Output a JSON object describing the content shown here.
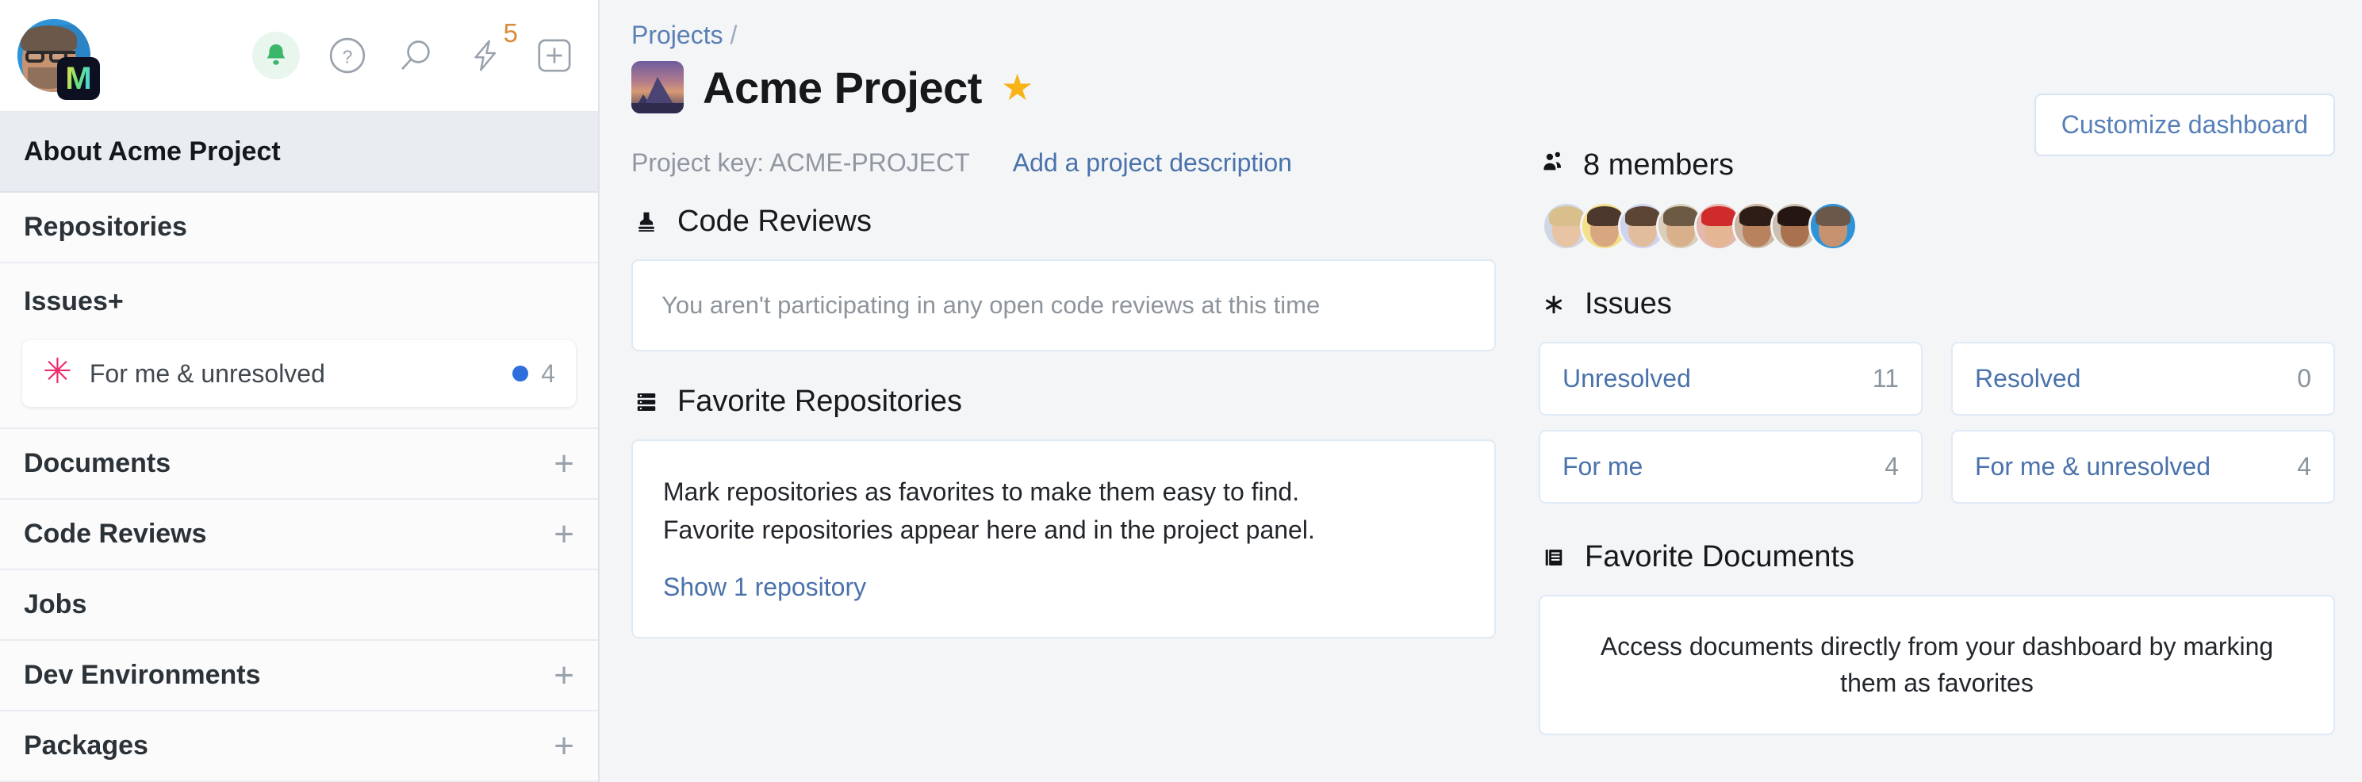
{
  "sidebar": {
    "user": {
      "avatar_name": "user-avatar",
      "badge_letter": "M"
    },
    "toolbar": [
      {
        "name": "notifications-bell-icon",
        "label": ""
      },
      {
        "name": "help-icon",
        "label": "?"
      },
      {
        "name": "search-icon",
        "label": ""
      },
      {
        "name": "activity-bolt-icon",
        "label": "",
        "badge": "5"
      },
      {
        "name": "create-plus-icon",
        "label": ""
      }
    ],
    "active_item": "About Acme Project",
    "items": [
      {
        "label": "Repositories",
        "has_add": false
      },
      {
        "label": "Issues",
        "has_add": true
      },
      {
        "label": "Documents",
        "has_add": true
      },
      {
        "label": "Code Reviews",
        "has_add": true
      },
      {
        "label": "Jobs",
        "has_add": false
      },
      {
        "label": "Dev Environments",
        "has_add": true
      },
      {
        "label": "Packages",
        "has_add": true
      }
    ],
    "issues_saved_search": {
      "label": "For me & unresolved",
      "count": "4",
      "icon": "asterisk-icon",
      "dot_color": "#2f6fdd"
    },
    "plus_glyph": "+"
  },
  "header": {
    "breadcrumb_root": "Projects",
    "breadcrumb_separator": "/",
    "project_title": "Acme Project",
    "favorite_star": "★",
    "customize_button": "Customize dashboard",
    "project_key_label": "Project key: ACME-PROJECT",
    "add_description_link": "Add a project description"
  },
  "left_column": {
    "code_reviews": {
      "heading": "Code Reviews",
      "icon": "stamp-icon",
      "empty_text": "You aren't participating in any open code reviews at this time"
    },
    "favorite_repositories": {
      "heading": "Favorite Repositories",
      "icon": "server-list-icon",
      "body_line1": "Mark repositories as favorites to make them easy to find.",
      "body_line2": "Favorite repositories appear here and in the project panel.",
      "show_link": "Show 1 repository"
    }
  },
  "right_column": {
    "members": {
      "heading": "8 members",
      "icon": "people-icon",
      "avatars": [
        {
          "name": "member-avatar-1",
          "bg": "#cfd7e2",
          "face": "#e8c3a4",
          "hair": "#d8bf8c"
        },
        {
          "name": "member-avatar-2",
          "bg": "#f3e08a",
          "face": "#d9a77f",
          "hair": "#4c382c"
        },
        {
          "name": "member-avatar-3",
          "bg": "#cfd4ee",
          "face": "#e2bd9d",
          "hair": "#5d4533"
        },
        {
          "name": "member-avatar-4",
          "bg": "#d9cfbb",
          "face": "#d8b18c",
          "hair": "#6d5a45"
        },
        {
          "name": "member-avatar-5",
          "bg": "#e4b8ae",
          "face": "#e4b694",
          "hair": "#cf2b2b"
        },
        {
          "name": "member-avatar-6",
          "bg": "#cbb6a4",
          "face": "#b8825e",
          "hair": "#2e1d16"
        },
        {
          "name": "member-avatar-7",
          "bg": "#cbc0b2",
          "face": "#a9714e",
          "hair": "#241612"
        },
        {
          "name": "member-avatar-8",
          "bg": "#2e93d9",
          "face": "#c79270",
          "hair": "#6b584a"
        }
      ]
    },
    "issues": {
      "heading": "Issues",
      "icon": "asterisk-icon",
      "cards": [
        {
          "label": "Unresolved",
          "count": "11"
        },
        {
          "label": "Resolved",
          "count": "0"
        },
        {
          "label": "For me",
          "count": "4"
        },
        {
          "label": "For me & unresolved",
          "count": "4"
        }
      ]
    },
    "favorite_documents": {
      "heading": "Favorite Documents",
      "icon": "document-icon",
      "empty_text": "Access documents directly from your dashboard by marking them as favorites"
    }
  },
  "colors": {
    "link": "#4a72ab",
    "accent_star": "#f8b319",
    "bell_green": "#3cb66a",
    "asterisk_pink": "#ee2b6c",
    "page_bg": "#f4f5f7",
    "sidebar_bg": "#fbfbfc"
  }
}
